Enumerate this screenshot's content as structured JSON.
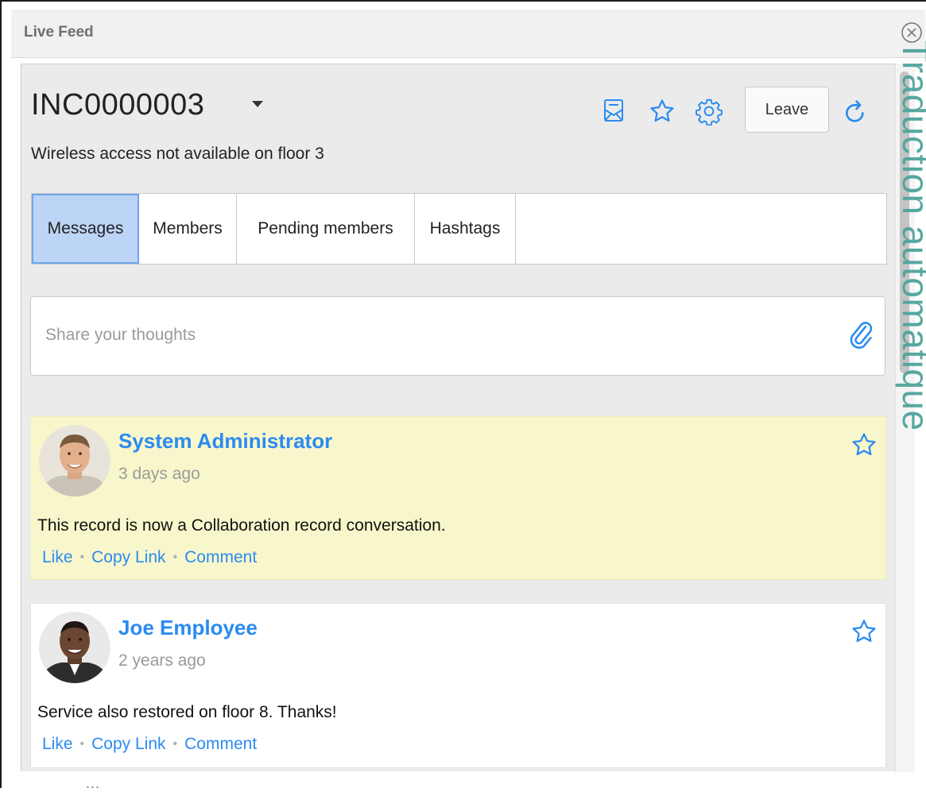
{
  "window": {
    "title": "Live Feed",
    "close_icon": "close-circle-icon"
  },
  "watermark": "Traduction automatique",
  "record": {
    "id": "INC0000003",
    "description": "Wireless access not available on floor 3",
    "header_icons": [
      "email-icon",
      "star-outline-icon",
      "gear-icon",
      "refresh-icon"
    ],
    "leave_label": "Leave"
  },
  "tabs": [
    {
      "label": "Messages",
      "active": true
    },
    {
      "label": "Members",
      "active": false
    },
    {
      "label": "Pending members",
      "active": false
    },
    {
      "label": "Hashtags",
      "active": false
    }
  ],
  "share": {
    "placeholder": "Share your thoughts",
    "attach_icon": "paperclip-icon"
  },
  "posts": [
    {
      "author": "System Administrator",
      "time": "3 days ago",
      "text": "This record is now a Collaboration record conversation.",
      "actions": [
        "Like",
        "Copy Link",
        "Comment"
      ],
      "highlight_color": "#f8f7cc"
    },
    {
      "author": "Joe Employee",
      "time": "2 years ago",
      "text": "Service also restored on floor 8. Thanks!",
      "actions": [
        "Like",
        "Copy Link",
        "Comment"
      ],
      "highlight_color": "#ffffff"
    }
  ],
  "footer": {
    "ellipsis": "..."
  },
  "colors": {
    "link": "#2b8bf0",
    "tab_active": "#bcd4f6",
    "watermark": "#4fa49a"
  }
}
